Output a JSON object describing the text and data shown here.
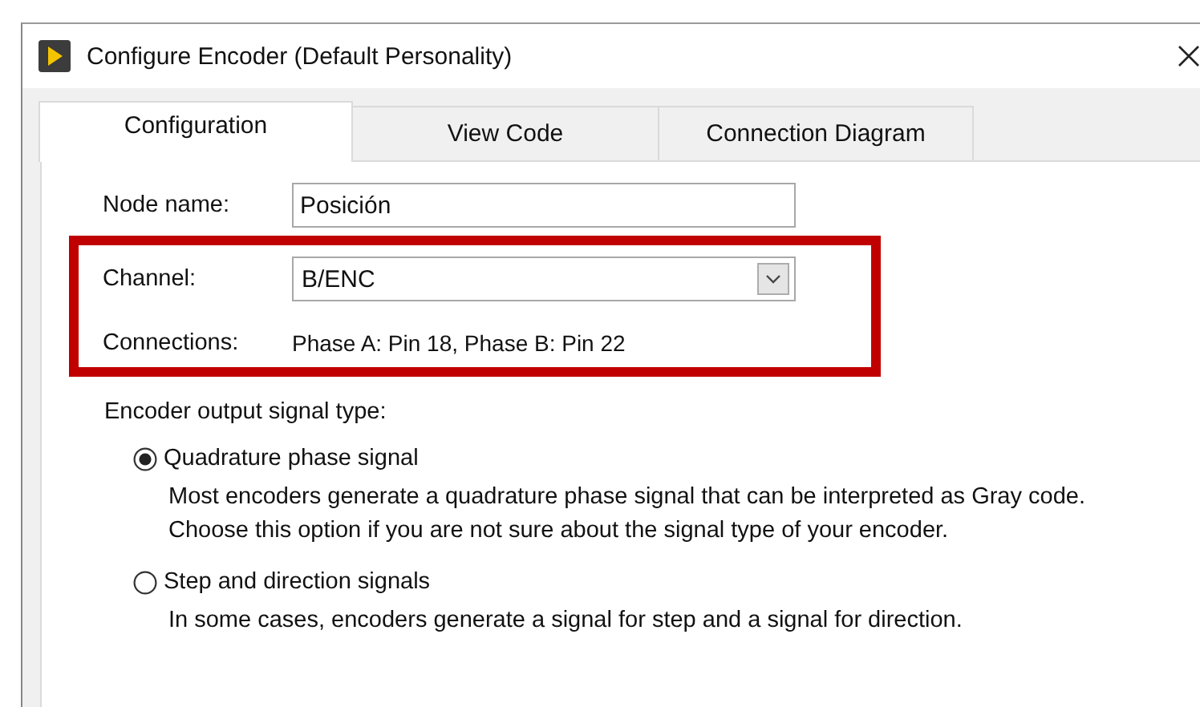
{
  "window": {
    "title": "Configure Encoder (Default Personality)"
  },
  "tabs": [
    {
      "label": "Configuration",
      "selected": true
    },
    {
      "label": "View Code",
      "selected": false
    },
    {
      "label": "Connection Diagram",
      "selected": false
    }
  ],
  "node_name": {
    "label": "Node name:",
    "value": "Posición"
  },
  "channel": {
    "label": "Channel:",
    "value": "B/ENC"
  },
  "connections": {
    "label": "Connections:",
    "value": "Phase A: Pin 18, Phase B: Pin 22"
  },
  "signal_type": {
    "label": "Encoder output signal type:",
    "options": [
      {
        "label": "Quadrature phase signal",
        "selected": true,
        "description": "Most encoders generate a quadrature phase signal that can be interpreted as Gray code. Choose this option if you are not sure about the signal type of your encoder."
      },
      {
        "label": "Step and direction signals",
        "selected": false,
        "description": "In some cases, encoders generate a signal for step and a signal for direction."
      }
    ]
  }
}
